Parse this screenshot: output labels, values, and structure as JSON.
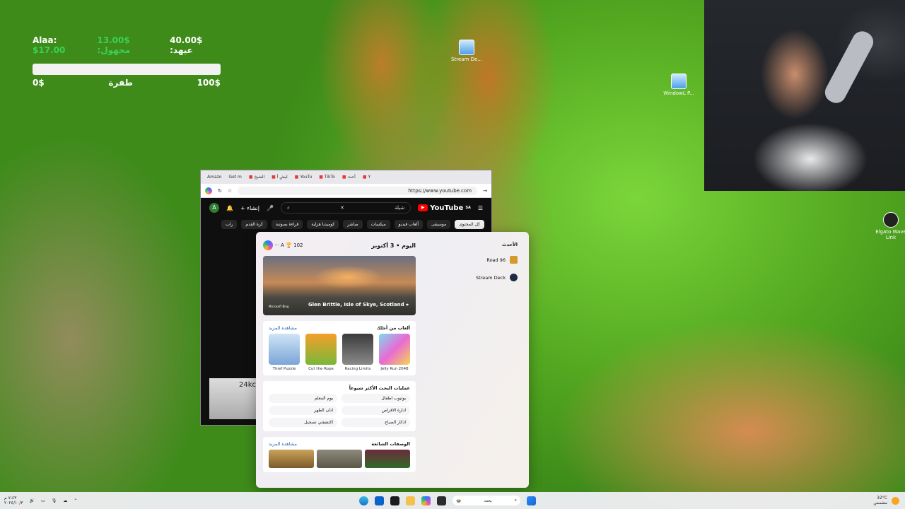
{
  "overlay": {
    "line_alaa_name": "Alaa:",
    "line_alaa_value": "$17.00",
    "line_unknown": "13.00$ :مجهول",
    "line_ihab": "40.00$ :عيهد",
    "bar_fill_fraction": 0,
    "min_label": "0$",
    "goal_label": "طفرة",
    "max_label": "100$"
  },
  "desktop_icons": [
    "Stream De...",
    "WindowL P...",
    "Elgato Wave Link"
  ],
  "browser": {
    "tabs": [
      "Amazo",
      "Get m",
      "الشيخ",
      "ليش أ",
      "YouTu",
      "TikTo",
      "أحث",
      "Y"
    ],
    "url": "https://www.youtube.com"
  },
  "youtube": {
    "logo": "YouTube",
    "logo_badge": "SA",
    "search_query": "شيلة",
    "create_label": "إنشاء",
    "avatar_letter": "A",
    "chips": [
      "كل المحتوى",
      "موسيقى",
      "ألعاب فيديو",
      "ميكسات",
      "مباشر",
      "كوميديا هزلية",
      "قراءة بصوتية",
      "كرة القدم",
      "راب"
    ],
    "thumb_text": "24kc"
  },
  "panel": {
    "date": "اليوم • 3 أكتوبر",
    "count_badge": "102",
    "avatar_letter": "A",
    "hero_caption": "Glen Brittle, Isle of Skye, Scotland",
    "hero_brand": "Microsoft Bing",
    "games_title": "ألعاب من أجلك",
    "games_more": "مشاهدة المزيد",
    "games": [
      "Thief Puzzle",
      "Cut the Rope",
      "Racing Limits",
      "Jelly Run 2048"
    ],
    "searches_title": "عمليات البحث الأكثر شيوعاً",
    "searches": [
      "يوتيوب اطفال",
      "يوم المعلم",
      "ادارة الافراص",
      "اذان الظهر",
      "اذكار الصباح",
      "اكتشفتي تسجيل"
    ],
    "recipes_title": "الوصفات الشائعة",
    "recipes_more": "مشاهدة المزيد",
    "recent_title": "الأحدث",
    "recent": [
      "Road 96",
      "Stream Deck"
    ]
  },
  "taskbar": {
    "search_placeholder": "بحث",
    "weather_temp": "32°C",
    "weather_desc": "مشمس",
    "time": "٧:٤٣ م",
    "date": "٢٠٢٤/١٠/٣"
  },
  "colors": {
    "goal_green": "#39d353",
    "yt_red": "#ff0000",
    "panel_link": "#1a5fb4"
  }
}
